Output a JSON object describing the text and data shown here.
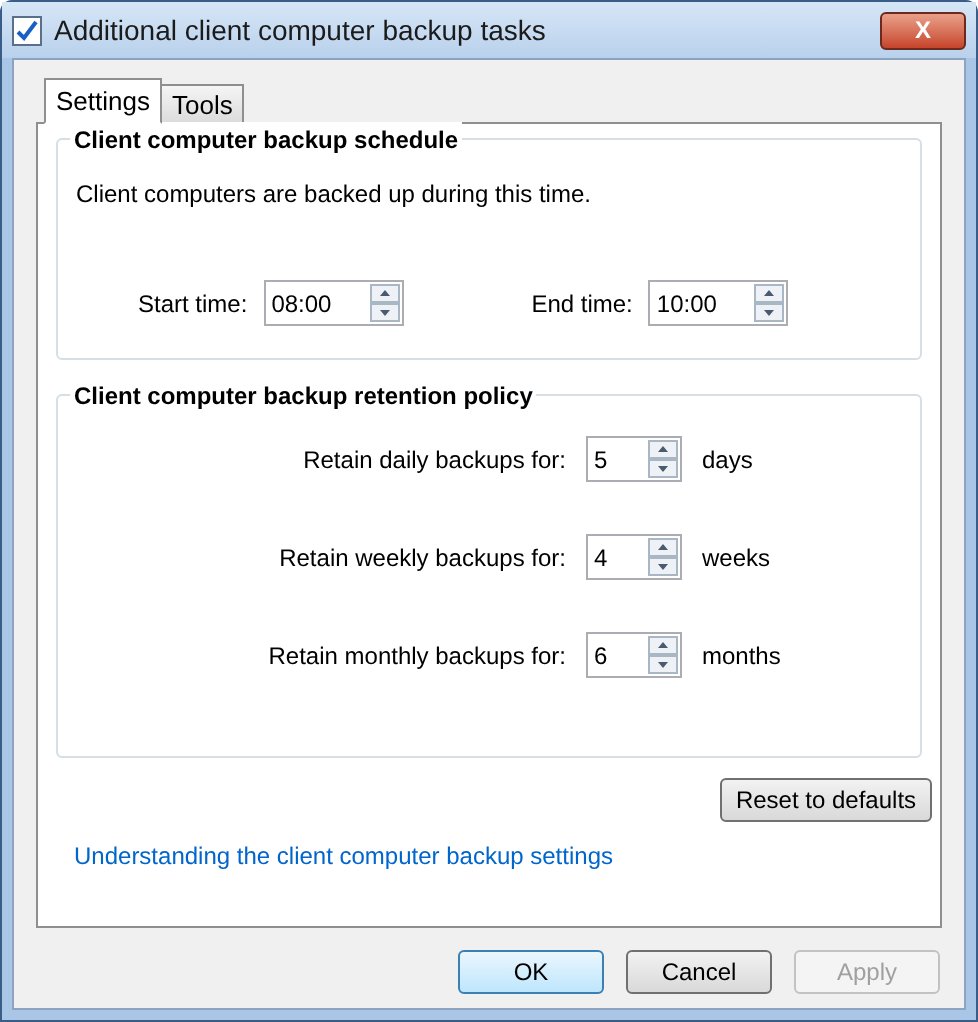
{
  "window": {
    "title": "Additional client computer backup tasks",
    "close": "X"
  },
  "tabs": [
    {
      "label": "Settings",
      "selected": true
    },
    {
      "label": "Tools",
      "selected": false
    }
  ],
  "schedule": {
    "heading": "Client computer backup schedule",
    "description": "Client computers are backed up during this time.",
    "fields": [
      {
        "label": "Start time:",
        "value": "08:00"
      },
      {
        "label": "End time:",
        "value": "10:00"
      }
    ]
  },
  "retention": {
    "heading": "Client computer backup retention policy",
    "rows": [
      {
        "label": "Retain daily backups for:",
        "value": "5",
        "unit": "days"
      },
      {
        "label": "Retain weekly backups for:",
        "value": "4",
        "unit": "weeks"
      },
      {
        "label": "Retain monthly backups for:",
        "value": "6",
        "unit": "months"
      }
    ]
  },
  "reset_button": "Reset to defaults",
  "link": "Understanding the client computer backup settings",
  "buttons": [
    {
      "label": "OK",
      "default": true,
      "disabled": false
    },
    {
      "label": "Cancel",
      "default": false,
      "disabled": false
    },
    {
      "label": "Apply",
      "default": false,
      "disabled": true
    }
  ]
}
